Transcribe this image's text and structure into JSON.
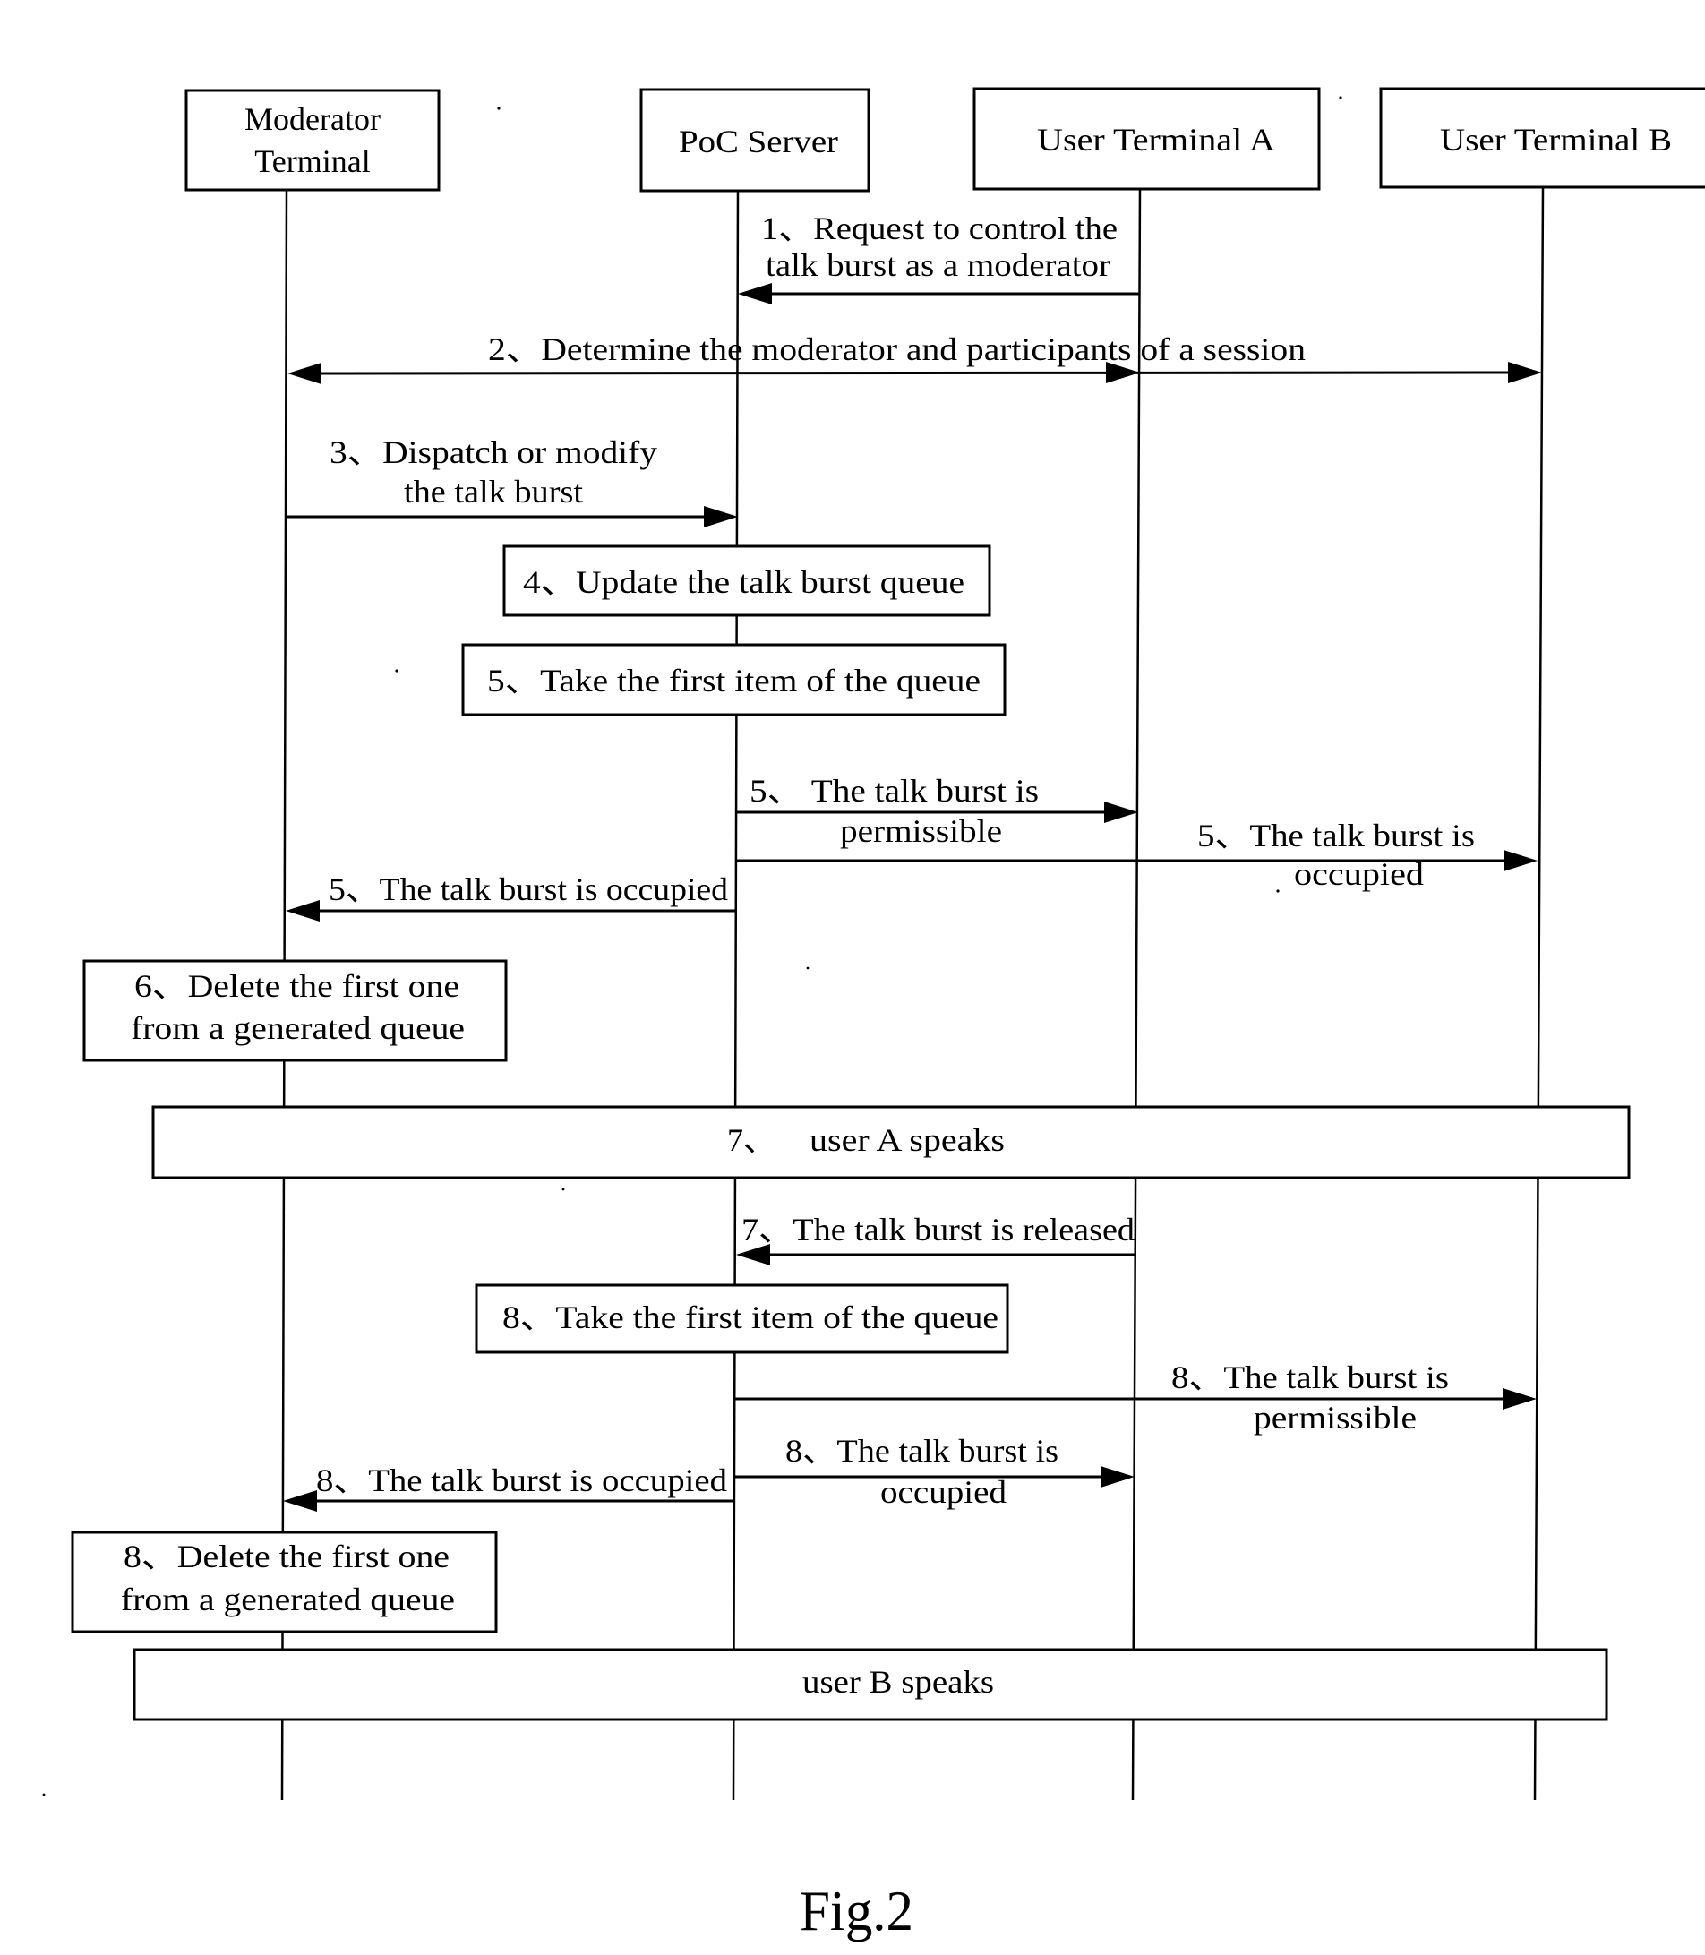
{
  "figure": {
    "caption": "Fig.2"
  },
  "participants": [
    {
      "id": "moderator",
      "lines": [
        "Moderator",
        "Terminal"
      ]
    },
    {
      "id": "poc_server",
      "lines": [
        "PoC Server"
      ]
    },
    {
      "id": "user_a",
      "lines": [
        "User Terminal A"
      ]
    },
    {
      "id": "user_b",
      "lines": [
        "User Terminal B"
      ]
    }
  ],
  "messages": {
    "m1": {
      "from": "user_a",
      "to": "poc_server",
      "lines": [
        "1、Request to control the",
        "talk burst as a moderator"
      ]
    },
    "m2": {
      "from": "poc_server",
      "to": [
        "moderator",
        "user_a",
        "user_b"
      ],
      "lines": [
        "2、Determine the moderator and participants of a session"
      ]
    },
    "m3": {
      "from": "moderator",
      "to": "poc_server",
      "lines": [
        "3、Dispatch or modify",
        "the talk burst"
      ]
    },
    "m5a": {
      "from": "poc_server",
      "to": "user_a",
      "lines": [
        "5、 The talk burst is",
        "permissible"
      ]
    },
    "m5b": {
      "from": "poc_server",
      "to": "user_b",
      "lines": [
        "5、The talk burst is",
        "occupied"
      ]
    },
    "m5c": {
      "from": "poc_server",
      "to": "moderator",
      "lines": [
        "5、The talk burst is occupied"
      ]
    },
    "m7": {
      "from": "user_a",
      "to": "poc_server",
      "lines": [
        "7、The talk burst is released"
      ]
    },
    "m8a": {
      "from": "poc_server",
      "to": "user_b",
      "lines": [
        "8、The talk burst is",
        "permissible"
      ]
    },
    "m8b": {
      "from": "poc_server",
      "to": "user_a",
      "lines": [
        "8、The talk burst is",
        "occupied"
      ]
    },
    "m8c": {
      "from": "poc_server",
      "to": "moderator",
      "lines": [
        "8、The talk burst is occupied"
      ]
    }
  },
  "process_boxes": {
    "b4": {
      "at": "poc_server",
      "lines": [
        "4、Update the talk burst queue"
      ]
    },
    "b5": {
      "at": "poc_server",
      "lines": [
        "5、Take the first item of the queue"
      ]
    },
    "b6": {
      "at": "moderator",
      "lines": [
        "6、Delete the first one",
        "from a generated queue"
      ]
    },
    "b7": {
      "at": "all",
      "lines": [
        "7、",
        "user A speaks"
      ]
    },
    "b8": {
      "at": "poc_server",
      "lines": [
        "8、Take the first item of the queue"
      ]
    },
    "b8d": {
      "at": "moderator",
      "lines": [
        "8、Delete the first one",
        "from a generated queue"
      ]
    },
    "bB": {
      "at": "all",
      "lines": [
        "user B speaks"
      ]
    }
  }
}
